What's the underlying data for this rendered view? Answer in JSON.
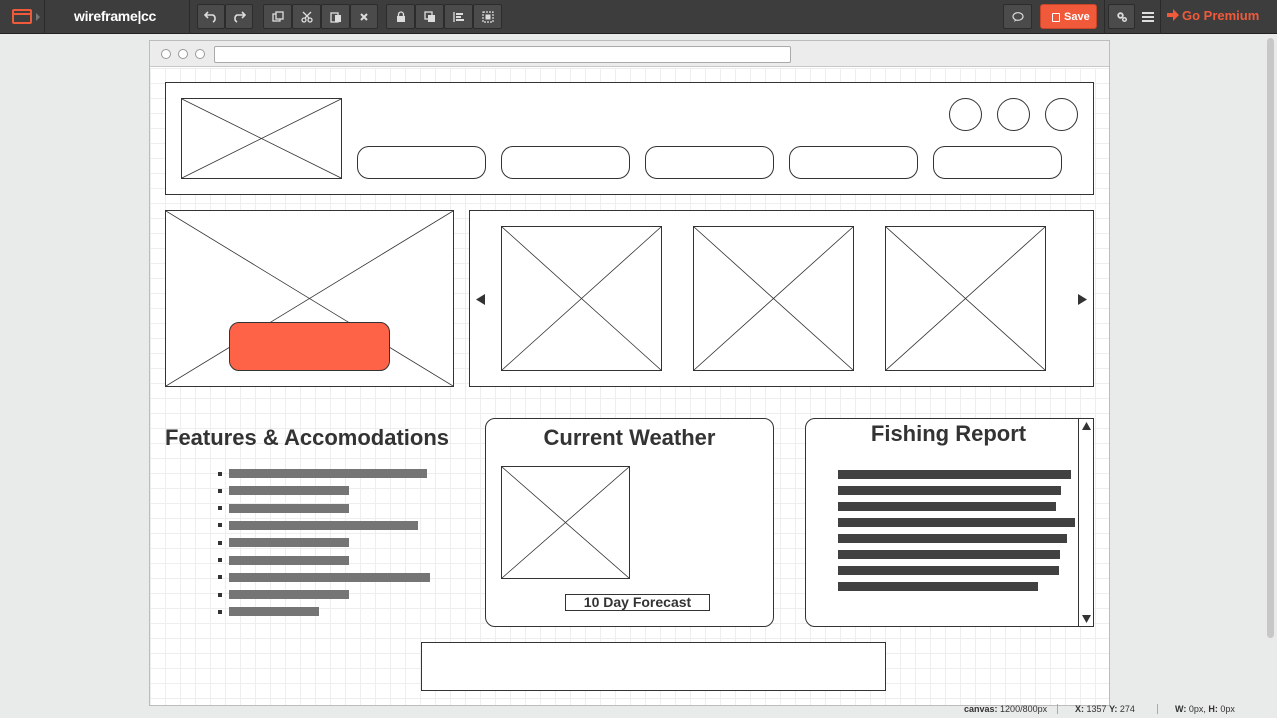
{
  "app": {
    "brand": "wireframe|cc"
  },
  "toolbar": {
    "buttons": [
      "undo-icon",
      "redo-icon",
      "duplicate-icon",
      "cut-icon",
      "paste-icon",
      "delete-icon",
      "lock-icon",
      "layer-icon",
      "align-icon",
      "group-icon"
    ],
    "comment_icon": "comment-icon",
    "save_label": "Save",
    "settings_icon": "settings-icon",
    "menu_icon": "menu-icon",
    "premium_label": "Go Premium"
  },
  "wireframe": {
    "features": {
      "title": "Features & Accomodations",
      "items": [
        {
          "fill": 0.66
        },
        {
          "fill": 0.4
        },
        {
          "fill": 0.4
        },
        {
          "fill": 0.63
        },
        {
          "fill": 0.4
        },
        {
          "fill": 0.4
        },
        {
          "fill": 0.67
        },
        {
          "fill": 0.4
        },
        {
          "fill": 0.3
        }
      ]
    },
    "weather": {
      "title": "Current Weather",
      "forecast_label": "10 Day Forecast"
    },
    "fishing": {
      "title": "Fishing Report",
      "line_count": 8
    },
    "carousel": {
      "prev_icon": "triangle-left-icon",
      "next_icon": "triangle-right-icon"
    },
    "accent_color": "#ff6347"
  },
  "status": {
    "canvas_label": "canvas:",
    "canvas_value": "1200/800px",
    "x_label": "X:",
    "x_value": "1357",
    "y_label": "Y:",
    "y_value": "274",
    "w_label": "W:",
    "w_value": "0px,",
    "h_label": "H:",
    "h_value": "0px"
  }
}
